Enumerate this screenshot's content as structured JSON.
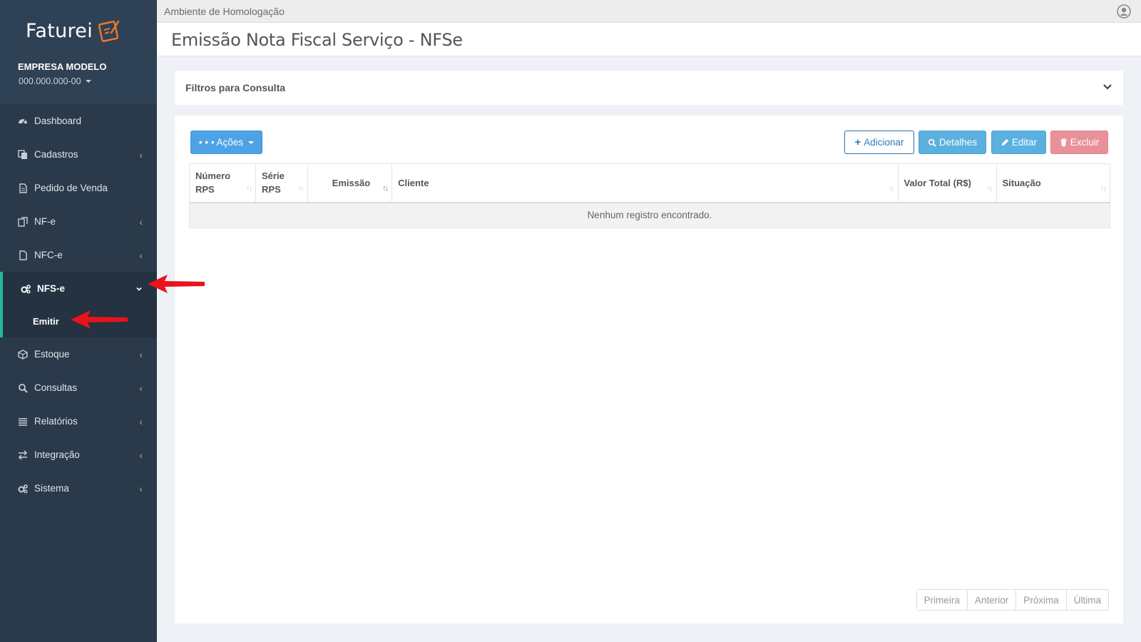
{
  "brand": {
    "logo_text": "Faturei",
    "company_name": "EMPRESA MODELO",
    "company_id": "000.000.000-00"
  },
  "sidebar": {
    "items": [
      {
        "label": "Dashboard",
        "icon": "dashboard-icon"
      },
      {
        "label": "Cadastros",
        "icon": "copy-icon"
      },
      {
        "label": "Pedido de Venda",
        "icon": "document-icon"
      },
      {
        "label": "NF-e",
        "icon": "docs-icon"
      },
      {
        "label": "NFC-e",
        "icon": "file-icon"
      },
      {
        "label": "NFS-e",
        "icon": "gears-icon",
        "active": true,
        "submenu": [
          "Emitir"
        ]
      },
      {
        "label": "Estoque",
        "icon": "cube-icon"
      },
      {
        "label": "Consultas",
        "icon": "search-icon"
      },
      {
        "label": "Relatórios",
        "icon": "list-icon"
      },
      {
        "label": "Integração",
        "icon": "exchange-icon"
      },
      {
        "label": "Sistema",
        "icon": "gears-icon"
      }
    ]
  },
  "topbar": {
    "environment": "Ambiente de Homologação"
  },
  "page": {
    "title": "Emissão Nota Fiscal Serviço - NFSe"
  },
  "filters": {
    "title": "Filtros para Consulta"
  },
  "toolbar": {
    "actions_label": "• • • Ações",
    "add_label": "Adicionar",
    "details_label": "Detalhes",
    "edit_label": "Editar",
    "delete_label": "Excluir"
  },
  "table": {
    "columns": [
      "Número RPS",
      "Série RPS",
      "Emissão",
      "Cliente",
      "Valor Total (R$)",
      "Situação"
    ],
    "empty_message": "Nenhum registro encontrado."
  },
  "pagination": {
    "first": "Primeira",
    "previous": "Anterior",
    "next": "Próxima",
    "last": "Última"
  },
  "colors": {
    "sidebar_bg": "#2b3a4a",
    "active_accent": "#26b99a",
    "primary_button": "#5bb0e0",
    "danger_button": "#e99198",
    "annotation_arrow": "#e8131b"
  }
}
